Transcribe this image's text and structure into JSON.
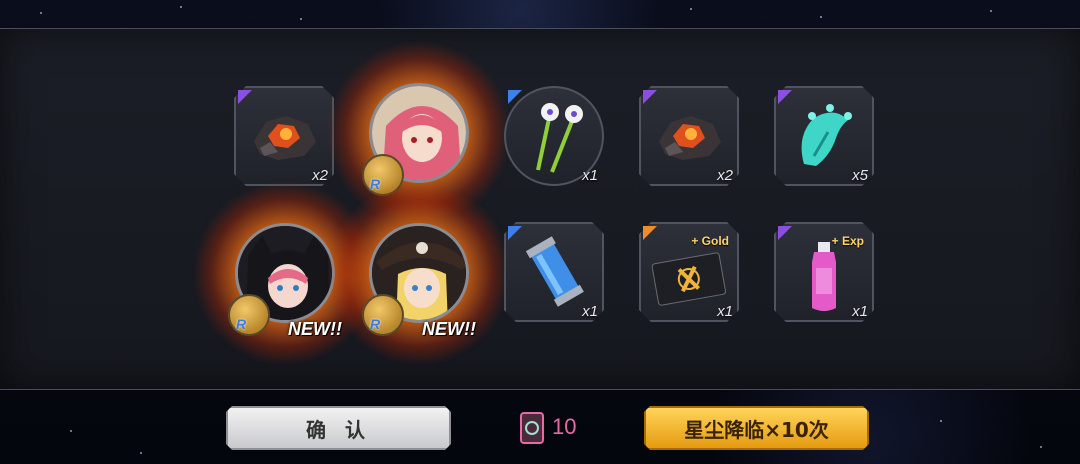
{
  "items": [
    {
      "name": "molten-ore-icon",
      "rarity": "purple",
      "qty": "x2"
    },
    {
      "name": "flower-sticks-icon",
      "rarity": "blue",
      "qty": "x1"
    },
    {
      "name": "molten-ore-icon",
      "rarity": "purple",
      "qty": "x2"
    },
    {
      "name": "crystal-claw-icon",
      "rarity": "purple",
      "qty": "x5"
    },
    {
      "name": "energy-canister-icon",
      "rarity": "blue",
      "qty": "x1"
    },
    {
      "name": "gold-card-icon",
      "rarity": "orange",
      "qty": "x1",
      "tag": "+ Gold"
    },
    {
      "name": "exp-bottle-icon",
      "rarity": "purple",
      "qty": "x1",
      "tag": "+ Exp"
    }
  ],
  "characters": [
    {
      "name": "pink-hair-girl-portrait",
      "badge": "R",
      "new": ""
    },
    {
      "name": "cat-hood-girl-portrait",
      "badge": "R",
      "new": "NEW!!"
    },
    {
      "name": "pirate-girl-portrait",
      "badge": "R",
      "new": "NEW!!"
    }
  ],
  "footer": {
    "confirm_label": "确 认",
    "ticket_count": "10",
    "gacha_label": "星尘降临×10次"
  },
  "colors": {
    "purple": "#8a4fe0",
    "blue": "#3f7fe8",
    "orange": "#f08a2a",
    "gold_button": "#f2b627",
    "ticket_text": "#e66aa4"
  }
}
